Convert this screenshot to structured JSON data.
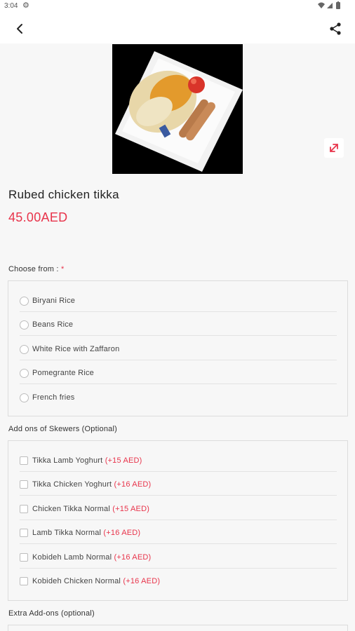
{
  "status_bar": {
    "time": "3:04"
  },
  "product": {
    "title": "Rubed chicken tikka",
    "price": "45.00AED"
  },
  "choose_section": {
    "label": "Choose from :",
    "required_mark": "*",
    "options": [
      "Biryani Rice",
      "Beans Rice",
      "White Rice with Zaffaron",
      "Pomegrante Rice",
      "French fries"
    ]
  },
  "skewers_section": {
    "label": "Add ons of Skewers (Optional)",
    "options": [
      {
        "name": "Tikka Lamb Yoghurt",
        "extra": "(+15 AED)"
      },
      {
        "name": "Tikka Chicken Yoghurt",
        "extra": "(+16 AED)"
      },
      {
        "name": "Chicken Tikka Normal",
        "extra": "(+15 AED)"
      },
      {
        "name": "Lamb Tikka Normal",
        "extra": "(+16 AED)"
      },
      {
        "name": "Kobideh Lamb Normal",
        "extra": "(+16 AED)"
      },
      {
        "name": "Kobideh Chicken Normal",
        "extra": "(+16 AED)"
      }
    ]
  },
  "extra_section": {
    "label": "Extra Add-ons (optional)"
  },
  "colors": {
    "accent": "#e8344b",
    "background": "#f7f7f7"
  }
}
